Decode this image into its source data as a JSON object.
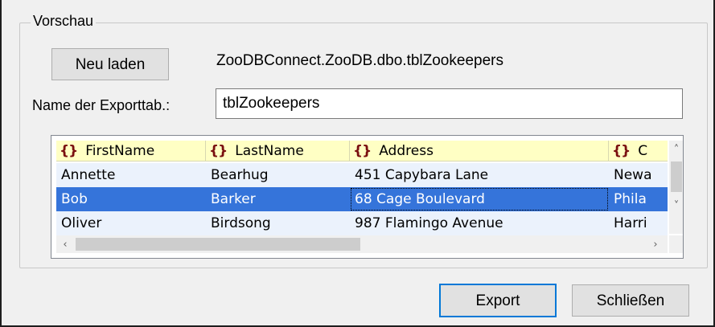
{
  "group": {
    "legend": "Vorschau"
  },
  "reload_button": {
    "label": "Neu laden"
  },
  "source": {
    "text": "ZooDBConnect.ZooDB.dbo.tblZookeepers"
  },
  "export_name": {
    "label": "Name der Exporttab.:",
    "value": "tblZookeepers"
  },
  "table": {
    "columns": [
      "FirstName",
      "LastName",
      "Address",
      "C"
    ],
    "column_icon": "braces-icon",
    "rows": [
      [
        "Annette",
        "Bearhug",
        "451 Capybara Lane",
        "Newa"
      ],
      [
        "Bob",
        "Barker",
        "68 Cage Boulevard",
        "Phila"
      ],
      [
        "Oliver",
        "Birdsong",
        "987 Flamingo Avenue",
        "Harri"
      ]
    ],
    "selected_row": 1
  },
  "buttons": {
    "export": "Export",
    "close": "Schließen"
  },
  "colors": {
    "header_bg": "#ffffc4",
    "selection": "#3574da",
    "alt_row": "#ebf2fc",
    "focus_border": "#0078d7",
    "column_icon": "#7a1010"
  }
}
